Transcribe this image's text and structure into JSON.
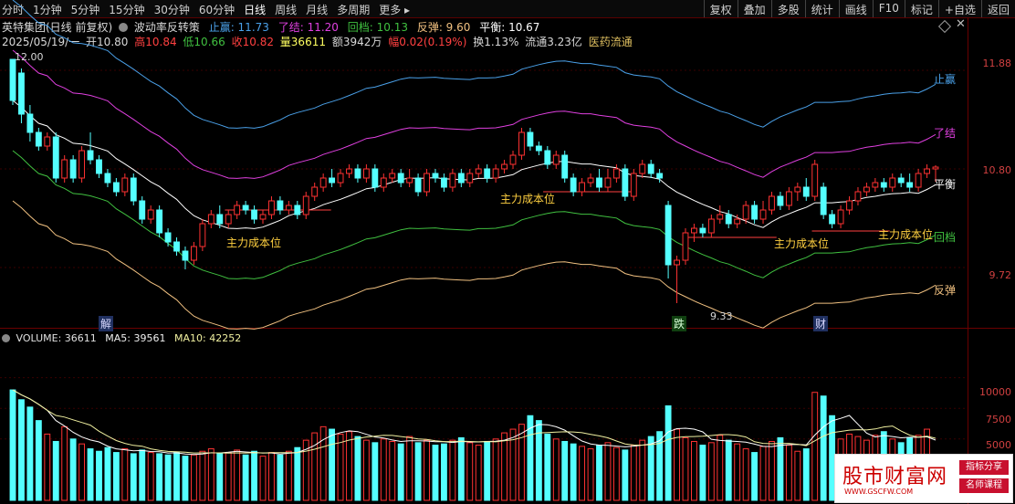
{
  "toolbar": {
    "tabs": [
      "分时",
      "1分钟",
      "5分钟",
      "15分钟",
      "30分钟",
      "60分钟",
      "日线",
      "周线",
      "月线",
      "多周期",
      "更多 ▸"
    ],
    "active": "日线",
    "right": [
      "复权",
      "叠加",
      "多股",
      "统计",
      "画线",
      "F10",
      "标记",
      "+自选",
      "返回"
    ]
  },
  "header": {
    "title": "英特集团(日线 前复权)",
    "indicator": "波动率反转策",
    "zhiying": "止赢: 11.73",
    "lejie": "了结: 11.20",
    "huidang": "回档: 10.13",
    "fantan": "反弹: 9.60",
    "pingheng": "平衡: 10.67",
    "date": "2025/05/19/一",
    "open": "开10.80",
    "high": "高10.84",
    "low": "低10.66",
    "close": "收10.82",
    "vol": "量36611",
    "amount": "额3942万",
    "change": "幅0.02(0.19%)",
    "turnover": "换1.13%",
    "float": "流通3.23亿",
    "sector": "医药流通"
  },
  "price_axis": [
    "11.88",
    "10.80",
    "9.72"
  ],
  "volume_axis": [
    "10000",
    "7500",
    "5000"
  ],
  "line_labels": {
    "zhiying": "止赢",
    "lejie": "了结",
    "pingheng": "平衡",
    "huidang": "回档",
    "fantan": "反弹"
  },
  "annotations": {
    "high_marker": "12.00",
    "low_marker": "9.33",
    "cost": "主力成本位"
  },
  "markers": {
    "jie": "解",
    "die": "跌",
    "cai": "财"
  },
  "volume_info": {
    "volume": "VOLUME: 36611",
    "ma5": "MA5: 39561",
    "ma10": "MA10: 42252"
  },
  "watermark": {
    "main": "股市财富网",
    "url": "WWW.GSCFW.COM",
    "tag1": "指标分享",
    "tag2": "名师课程"
  },
  "colors": {
    "up": "#ff3232",
    "down": "#54ffff",
    "zhiying": "#4aa0e8",
    "lejie": "#e040e0",
    "pingheng": "#ffffff",
    "huidang": "#40c040",
    "fantan": "#f0c080",
    "cost": "#ff4040",
    "volma10": "#f0f0a0"
  },
  "chart_data": {
    "type": "candlestick",
    "ylim": [
      9.2,
      12.1
    ],
    "candles": [
      [
        12.0,
        11.55,
        12.0,
        11.5
      ],
      [
        11.85,
        11.4,
        11.9,
        11.3
      ],
      [
        11.4,
        11.2,
        11.5,
        11.1
      ],
      [
        11.2,
        11.05,
        11.25,
        11.0
      ],
      [
        11.05,
        11.15,
        11.2,
        11.0
      ],
      [
        11.15,
        10.7,
        11.2,
        10.65
      ],
      [
        10.7,
        10.9,
        10.95,
        10.65
      ],
      [
        10.9,
        10.7,
        10.95,
        10.65
      ],
      [
        10.7,
        11.0,
        11.05,
        10.65
      ],
      [
        11.0,
        10.9,
        11.2,
        10.85
      ],
      [
        10.9,
        10.75,
        10.95,
        10.7
      ],
      [
        10.75,
        10.65,
        10.8,
        10.6
      ],
      [
        10.65,
        10.55,
        10.7,
        10.5
      ],
      [
        10.55,
        10.7,
        10.75,
        10.5
      ],
      [
        10.7,
        10.45,
        10.75,
        10.4
      ],
      [
        10.45,
        10.25,
        10.5,
        10.2
      ],
      [
        10.25,
        10.35,
        10.4,
        10.2
      ],
      [
        10.35,
        10.1,
        10.4,
        10.05
      ],
      [
        10.1,
        10.0,
        10.15,
        9.95
      ],
      [
        10.0,
        9.9,
        10.05,
        9.85
      ],
      [
        9.9,
        9.8,
        9.95,
        9.7
      ],
      [
        9.8,
        9.95,
        10.0,
        9.75
      ],
      [
        9.95,
        10.2,
        10.25,
        9.9
      ],
      [
        10.2,
        10.3,
        10.35,
        10.15
      ],
      [
        10.3,
        10.2,
        10.4,
        10.15
      ],
      [
        10.2,
        10.3,
        10.35,
        10.15
      ],
      [
        10.3,
        10.4,
        10.45,
        10.25
      ],
      [
        10.4,
        10.35,
        10.45,
        10.3
      ],
      [
        10.35,
        10.25,
        10.4,
        10.2
      ],
      [
        10.25,
        10.3,
        10.35,
        10.2
      ],
      [
        10.3,
        10.45,
        10.5,
        10.25
      ],
      [
        10.45,
        10.35,
        10.5,
        10.3
      ],
      [
        10.35,
        10.4,
        10.45,
        10.3
      ],
      [
        10.4,
        10.3,
        10.45,
        10.25
      ],
      [
        10.3,
        10.5,
        10.55,
        10.25
      ],
      [
        10.5,
        10.6,
        10.65,
        10.45
      ],
      [
        10.6,
        10.7,
        10.75,
        10.55
      ],
      [
        10.7,
        10.65,
        10.8,
        10.6
      ],
      [
        10.65,
        10.75,
        10.8,
        10.6
      ],
      [
        10.75,
        10.8,
        10.85,
        10.7
      ],
      [
        10.8,
        10.7,
        10.85,
        10.65
      ],
      [
        10.7,
        10.8,
        10.85,
        10.65
      ],
      [
        10.8,
        10.6,
        10.85,
        10.55
      ],
      [
        10.6,
        10.7,
        10.75,
        10.55
      ],
      [
        10.7,
        10.75,
        10.8,
        10.65
      ],
      [
        10.75,
        10.65,
        10.8,
        10.6
      ],
      [
        10.65,
        10.7,
        10.8,
        10.6
      ],
      [
        10.7,
        10.55,
        10.75,
        10.5
      ],
      [
        10.55,
        10.75,
        10.8,
        10.5
      ],
      [
        10.75,
        10.7,
        10.8,
        10.65
      ],
      [
        10.7,
        10.6,
        10.75,
        10.55
      ],
      [
        10.6,
        10.75,
        10.8,
        10.55
      ],
      [
        10.75,
        10.65,
        10.8,
        10.6
      ],
      [
        10.65,
        10.75,
        10.8,
        10.6
      ],
      [
        10.75,
        10.8,
        10.85,
        10.7
      ],
      [
        10.8,
        10.7,
        10.85,
        10.65
      ],
      [
        10.7,
        10.8,
        10.85,
        10.65
      ],
      [
        10.8,
        10.85,
        10.9,
        10.75
      ],
      [
        10.85,
        10.95,
        11.0,
        10.8
      ],
      [
        10.95,
        11.2,
        11.25,
        10.9
      ],
      [
        11.2,
        11.05,
        11.25,
        11.0
      ],
      [
        11.05,
        11.0,
        11.1,
        10.95
      ],
      [
        11.0,
        10.85,
        11.05,
        10.8
      ],
      [
        10.85,
        10.95,
        11.0,
        10.8
      ],
      [
        10.95,
        10.7,
        11.0,
        10.65
      ],
      [
        10.7,
        10.55,
        10.75,
        10.5
      ],
      [
        10.55,
        10.65,
        10.7,
        10.5
      ],
      [
        10.65,
        10.7,
        10.75,
        10.6
      ],
      [
        10.7,
        10.6,
        10.8,
        10.55
      ],
      [
        10.6,
        10.7,
        10.8,
        10.55
      ],
      [
        10.7,
        10.8,
        10.85,
        10.65
      ],
      [
        10.8,
        10.5,
        10.85,
        10.45
      ],
      [
        10.5,
        10.75,
        10.8,
        10.45
      ],
      [
        10.75,
        10.85,
        10.9,
        10.7
      ],
      [
        10.85,
        10.75,
        10.9,
        10.7
      ],
      [
        10.75,
        10.7,
        10.8,
        10.65
      ],
      [
        10.4,
        9.75,
        10.45,
        9.6
      ],
      [
        9.75,
        9.8,
        9.85,
        9.33
      ],
      [
        9.8,
        10.1,
        10.15,
        9.75
      ],
      [
        10.1,
        10.15,
        10.2,
        10.0
      ],
      [
        10.15,
        10.1,
        10.2,
        10.05
      ],
      [
        10.1,
        10.25,
        10.3,
        10.05
      ],
      [
        10.25,
        10.3,
        10.4,
        10.2
      ],
      [
        10.3,
        10.2,
        10.35,
        10.15
      ],
      [
        10.2,
        10.25,
        10.3,
        10.15
      ],
      [
        10.25,
        10.4,
        10.45,
        10.2
      ],
      [
        10.4,
        10.25,
        10.45,
        10.2
      ],
      [
        10.25,
        10.35,
        10.45,
        10.2
      ],
      [
        10.35,
        10.5,
        10.55,
        10.3
      ],
      [
        10.5,
        10.4,
        10.55,
        10.35
      ],
      [
        10.4,
        10.55,
        10.6,
        10.35
      ],
      [
        10.55,
        10.6,
        10.65,
        10.45
      ],
      [
        10.6,
        10.5,
        10.7,
        10.45
      ],
      [
        10.5,
        10.85,
        10.9,
        10.45
      ],
      [
        10.6,
        10.3,
        10.65,
        10.25
      ],
      [
        10.3,
        10.2,
        10.35,
        10.15
      ],
      [
        10.2,
        10.35,
        10.4,
        10.15
      ],
      [
        10.35,
        10.45,
        10.5,
        10.3
      ],
      [
        10.45,
        10.55,
        10.6,
        10.4
      ],
      [
        10.55,
        10.6,
        10.65,
        10.5
      ],
      [
        10.6,
        10.65,
        10.7,
        10.55
      ],
      [
        10.65,
        10.6,
        10.7,
        10.55
      ],
      [
        10.6,
        10.7,
        10.75,
        10.55
      ],
      [
        10.7,
        10.65,
        10.75,
        10.6
      ],
      [
        10.65,
        10.6,
        10.75,
        10.55
      ],
      [
        10.6,
        10.75,
        10.8,
        10.55
      ],
      [
        10.75,
        10.8,
        10.85,
        10.7
      ],
      [
        10.8,
        10.82,
        10.84,
        10.66
      ]
    ],
    "volumes": [
      9000,
      8200,
      7600,
      6500,
      5400,
      4800,
      6000,
      5000,
      4600,
      4200,
      4000,
      4300,
      3900,
      4200,
      3800,
      4100,
      3900,
      3800,
      3700,
      3900,
      3600,
      3700,
      4000,
      4200,
      3800,
      3900,
      4100,
      3700,
      4000,
      3600,
      3900,
      3700,
      4000,
      4300,
      4900,
      5500,
      6000,
      5800,
      5400,
      5600,
      5200,
      4900,
      4700,
      5000,
      4800,
      4600,
      5200,
      4700,
      4900,
      4500,
      4600,
      4900,
      5100,
      4700,
      4500,
      4800,
      5000,
      5500,
      5800,
      6200,
      6900,
      6500,
      5400,
      5000,
      4800,
      4600,
      4400,
      4200,
      4500,
      4700,
      4300,
      4100,
      4500,
      4900,
      5200,
      5600,
      7700,
      5800,
      5100,
      4800,
      4500,
      4700,
      5300,
      4900,
      4600,
      4200,
      3900,
      4400,
      4800,
      5100,
      4500,
      4000,
      4200,
      8800,
      8500,
      6900,
      5000,
      5400,
      5200,
      4900,
      5300,
      5600,
      5000,
      4700,
      5100,
      5300,
      5800,
      3661
    ]
  }
}
